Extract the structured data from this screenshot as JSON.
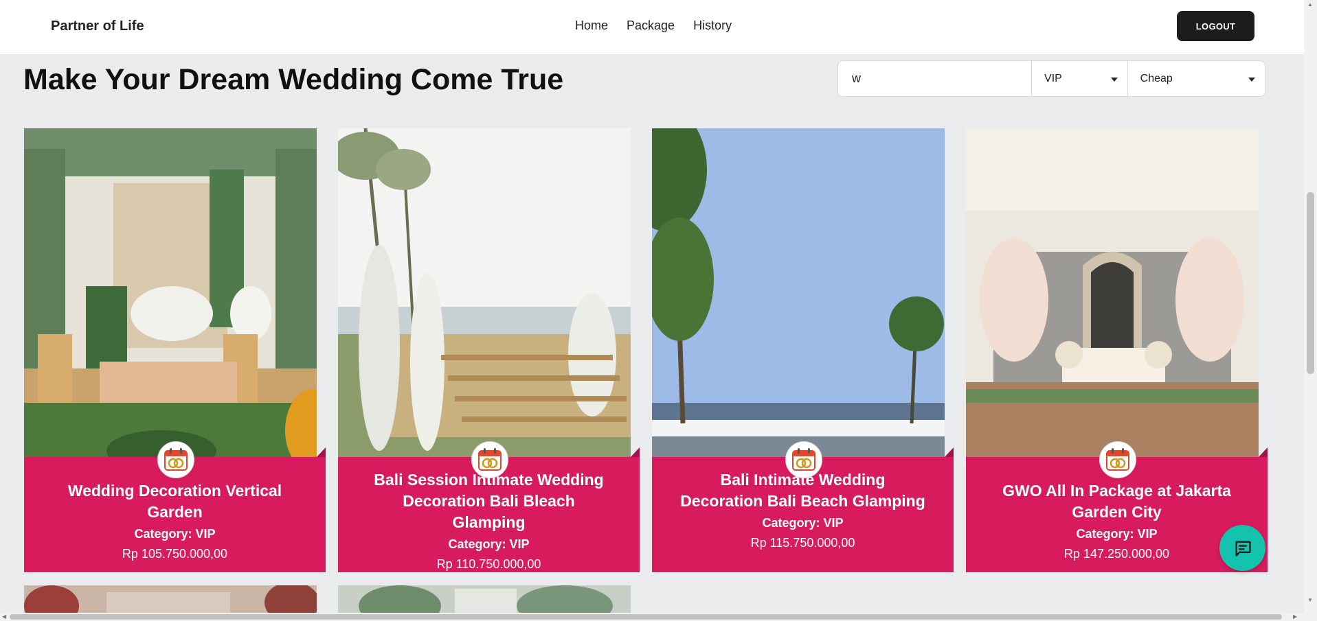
{
  "nav": {
    "brand": "Partner of Life",
    "links": [
      "Home",
      "Package",
      "History"
    ],
    "logout_label": "LOGOUT"
  },
  "page": {
    "title": "Make Your Dream Wedding Come True"
  },
  "filters": {
    "search_value": "w",
    "category_selected": "VIP",
    "sort_selected": "Cheap"
  },
  "packages": [
    {
      "title": "Wedding Decoration Vertical Garden",
      "category": "Category: VIP",
      "price": "Rp 105.750.000,00"
    },
    {
      "title": "Bali Session Intimate Wedding Decoration Bali Bleach Glamping",
      "category": "Category: VIP",
      "price": "Rp 110.750.000,00"
    },
    {
      "title": "Bali Intimate Wedding Decoration Bali Beach Glamping",
      "category": "Category: VIP",
      "price": "Rp 115.750.000,00"
    },
    {
      "title": "GWO All In Package at Jakarta Garden City",
      "category": "Category: VIP",
      "price": "Rp 147.250.000,00"
    }
  ],
  "icons": {
    "package_badge": "wedding-rings-calendar-icon",
    "chat": "chat-bubble-icon"
  },
  "colors": {
    "accent": "#d81b5c",
    "chat": "#14c3ad",
    "logout": "#1c1d1f"
  }
}
